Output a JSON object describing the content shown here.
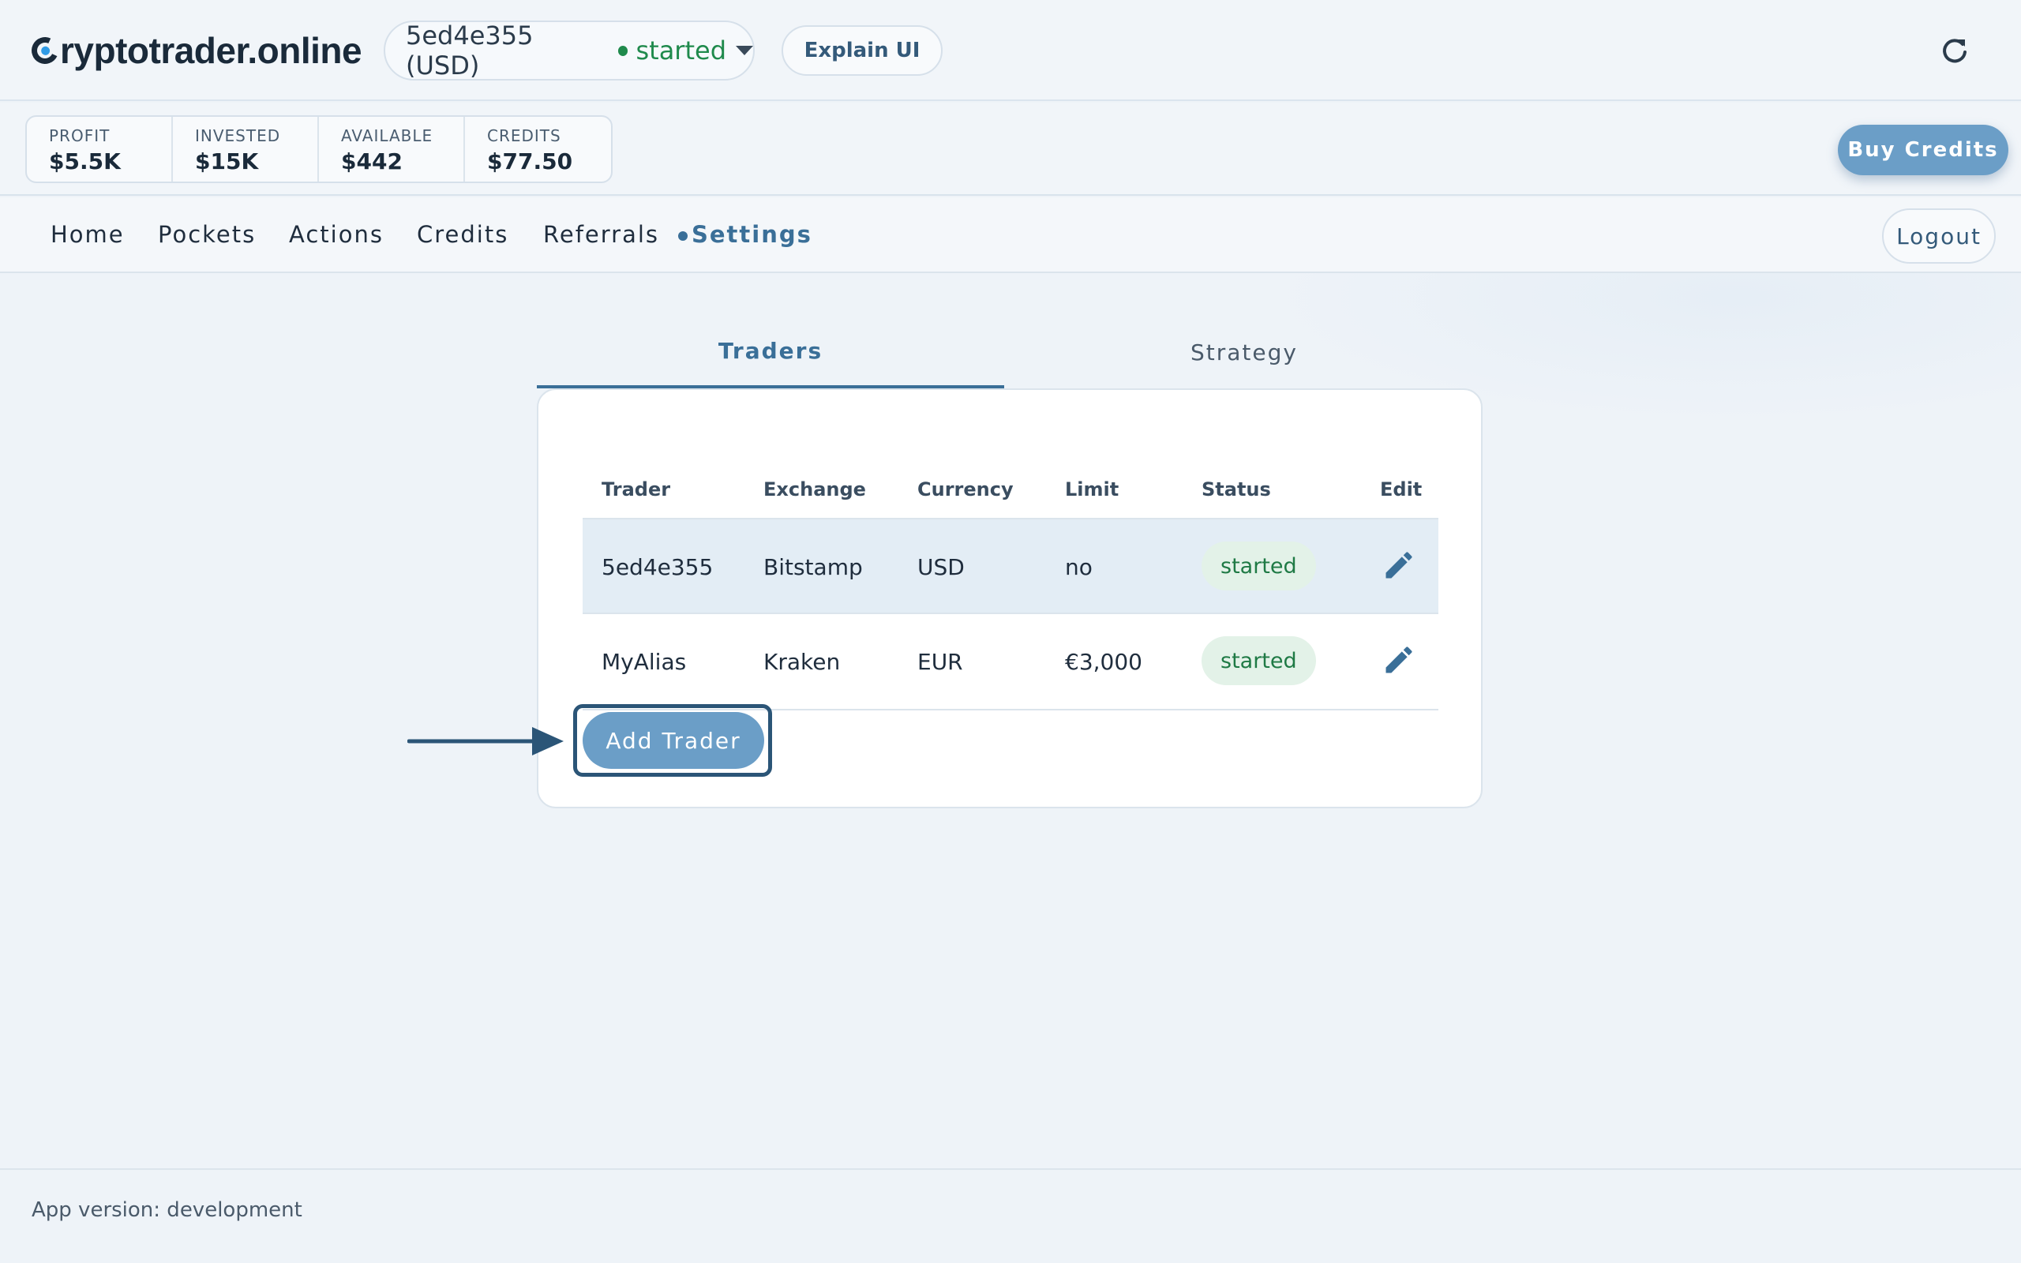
{
  "header": {
    "logo_text": "ryptotrader.online",
    "trader_selector": {
      "label": "5ed4e355 (USD)",
      "status": "started"
    },
    "explain_label": "Explain UI",
    "refresh_icon": "refresh-icon"
  },
  "stats": [
    {
      "label": "PROFIT",
      "value": "$5.5K"
    },
    {
      "label": "INVESTED",
      "value": "$15K"
    },
    {
      "label": "AVAILABLE",
      "value": "$442"
    },
    {
      "label": "CREDITS",
      "value": "$77.50"
    }
  ],
  "buy_credits_label": "Buy Credits",
  "nav": {
    "items": [
      "Home",
      "Pockets",
      "Actions",
      "Credits",
      "Referrals",
      "Settings"
    ],
    "active": "Settings",
    "logout_label": "Logout"
  },
  "tabs": [
    {
      "label": "Traders",
      "active": true
    },
    {
      "label": "Strategy",
      "active": false
    }
  ],
  "table": {
    "headers": [
      "Trader",
      "Exchange",
      "Currency",
      "Limit",
      "Status",
      "Edit"
    ],
    "rows": [
      {
        "trader": "5ed4e355",
        "exchange": "Bitstamp",
        "currency": "USD",
        "limit": "no",
        "status": "started",
        "selected": true
      },
      {
        "trader": "MyAlias",
        "exchange": "Kraken",
        "currency": "EUR",
        "limit": "€3,000",
        "status": "started",
        "selected": false
      }
    ]
  },
  "add_trader_label": "Add Trader",
  "footer": {
    "version_text": "App version: development"
  },
  "colors": {
    "accent": "#3a6f98",
    "button": "#6b9ec7",
    "status_green": "#1f8a4c",
    "selected_row": "#e3edf5"
  }
}
